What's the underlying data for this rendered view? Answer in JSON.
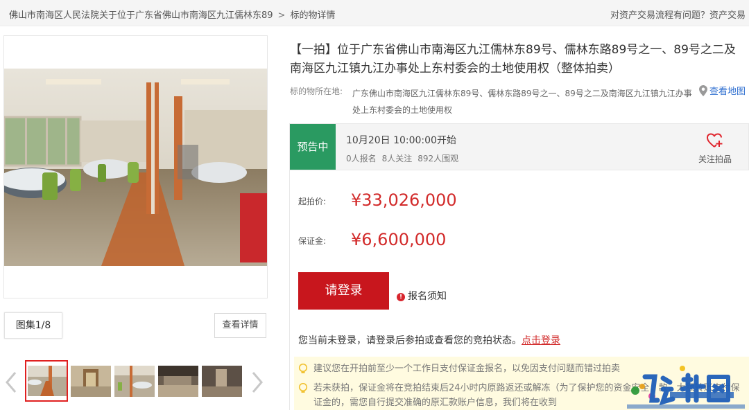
{
  "breadcrumb": {
    "court": "佛山市南海区人民法院关于位于广东省佛山市南海区九江儒林东89",
    "separator": ">",
    "current": "标的物详情"
  },
  "help": {
    "text": "对资产交易流程有问题？资产交易"
  },
  "gallery": {
    "count_label": "图集1/8",
    "detail_button": "查看详情"
  },
  "item": {
    "title": "【一拍】位于广东省佛山市南海区九江儒林东89号、儒林东路89号之一、89号之二及南海区九江镇九江办事处上东村委会的土地使用权（整体拍卖）",
    "location_label": "标的物所在地:",
    "location": "广东佛山市南海区九江儒林东89号、儒林东路89号之一、89号之二及南海区九江镇九江办事处上东村委会的土地使用权",
    "map_link": "查看地图"
  },
  "status": {
    "badge": "预告中",
    "start_time": "10月20日 10:00:00开始",
    "registrations": "0人报名",
    "followers": "8人关注",
    "viewers": "892人围观",
    "follow_label": "关注拍品"
  },
  "price": {
    "start_label": "起拍价:",
    "start_value": "¥33,026,000",
    "deposit_label": "保证金:",
    "deposit_value": "¥6,600,000"
  },
  "actions": {
    "login_button": "请登录",
    "notice_link": "报名须知",
    "login_hint": "您当前未登录，请登录后参拍或查看您的竞拍状态。",
    "login_link": "点击登录"
  },
  "tips": [
    "建议您在开拍前至少一个工作日支付保证金报名，以免因支付问题而错过拍卖",
    "若未获拍，保证金将在竞拍结束后24小时内原路返还或解冻（为了保护您的资金安全，款，大额转账支付保证金的，需您自行提交准确的原汇款账户信息，我们将在收到"
  ],
  "colors": {
    "accent_red": "#c8161d",
    "price_red": "#d22a2a",
    "status_green": "#2a9a61",
    "link_blue": "#2f6fd0",
    "tip_bg": "#fffbe0"
  }
}
